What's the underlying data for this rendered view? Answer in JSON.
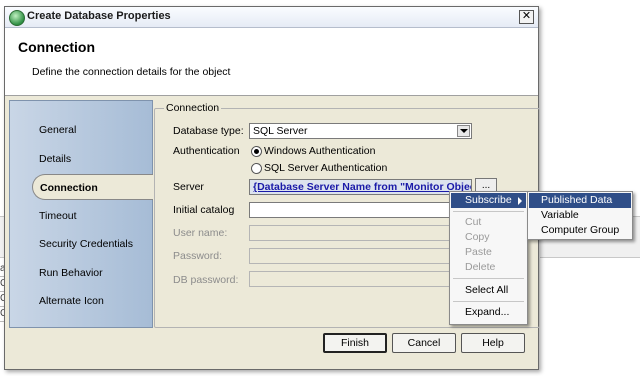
{
  "window": {
    "title": "Create Database Properties"
  },
  "header": {
    "title": "Connection",
    "subtitle": "Define the connection details for the object"
  },
  "sidebar": {
    "items": [
      {
        "label": "General"
      },
      {
        "label": "Details"
      },
      {
        "label": "Connection"
      },
      {
        "label": "Timeout"
      },
      {
        "label": "Security Credentials"
      },
      {
        "label": "Run Behavior"
      },
      {
        "label": "Alternate Icon"
      }
    ],
    "active": "Connection"
  },
  "connection": {
    "group_label": "Connection",
    "database_type_label": "Database type:",
    "database_type_value": "SQL Server",
    "authentication_label": "Authentication",
    "auth_windows": "Windows Authentication",
    "auth_sql": "SQL Server Authentication",
    "server_label": "Server",
    "server_value": "{Database Server Name from \"Monitor Object\"}",
    "browse_label": "...",
    "catalog_label": "Initial catalog",
    "username_label": "User name:",
    "password_label": "Password:",
    "dbpassword_label": "DB password:"
  },
  "buttons": {
    "finish": "Finish",
    "cancel": "Cancel",
    "help": "Help"
  },
  "context_menu": {
    "subscribe": "Subscribe",
    "cut": "Cut",
    "copy": "Copy",
    "paste": "Paste",
    "delete": "Delete",
    "select_all": "Select All",
    "expand": "Expand..."
  },
  "submenu": {
    "items": [
      "Published Data",
      "Variable",
      "Computer Group"
    ]
  },
  "background_app": {
    "glyphs": [
      "ar",
      "C",
      "C",
      "C"
    ]
  },
  "colors": {
    "highlight": "#2f4e88",
    "server_link": "#1a1aa8"
  }
}
